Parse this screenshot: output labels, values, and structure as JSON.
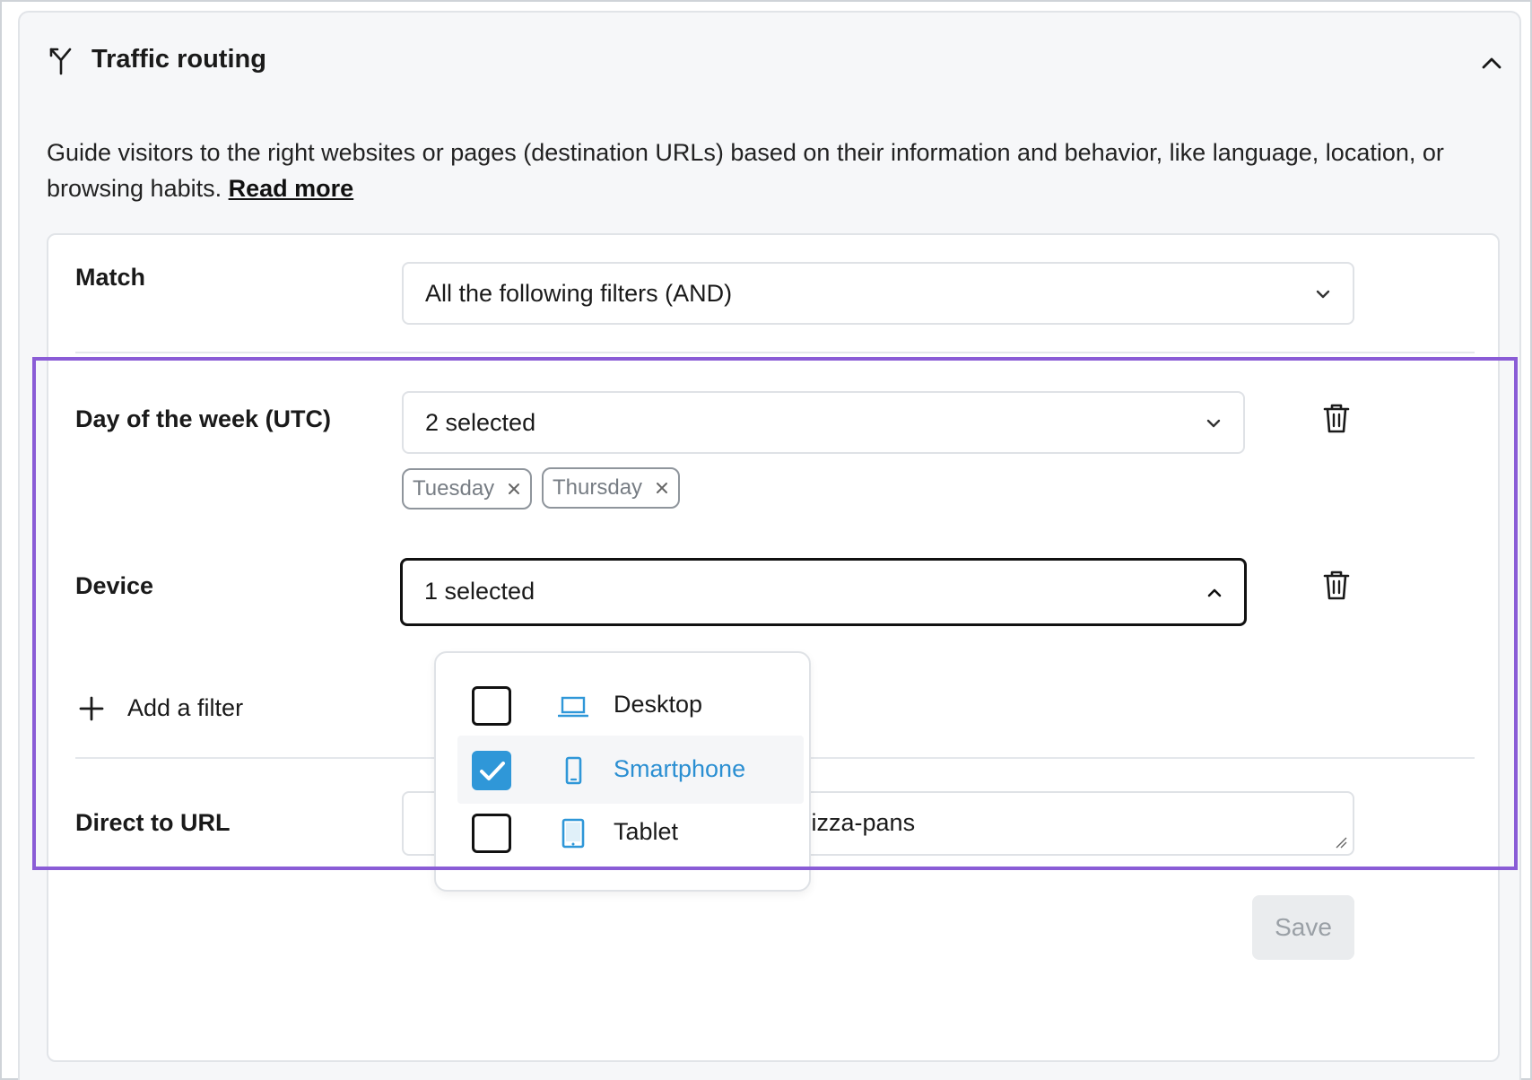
{
  "panel": {
    "title": "Traffic routing",
    "description": "Guide visitors to the right websites or pages (destination URLs) based on their information and behavior, like language, location, or browsing habits.",
    "read_more": "Read more"
  },
  "match": {
    "label": "Match",
    "value": "All the following filters (AND)"
  },
  "filters": [
    {
      "label": "Day of the week (UTC)",
      "value": "2 selected",
      "chips": [
        "Tuesday",
        "Thursday"
      ]
    },
    {
      "label": "Device",
      "value": "1 selected",
      "expanded": true
    }
  ],
  "device_options": [
    {
      "label": "Desktop",
      "checked": false,
      "icon": "laptop-icon"
    },
    {
      "label": "Smartphone",
      "checked": true,
      "icon": "smartphone-icon"
    },
    {
      "label": "Tablet",
      "checked": false,
      "icon": "tablet-icon"
    }
  ],
  "add_filter": "Add a filter",
  "direct_to_url": {
    "label": "Direct to URL",
    "value": "/pizza-pans"
  },
  "save_label": "Save",
  "colors": {
    "accent": "#2f97d8",
    "highlight": "#8a5cd6",
    "panel_bg": "#f6f7f9"
  }
}
